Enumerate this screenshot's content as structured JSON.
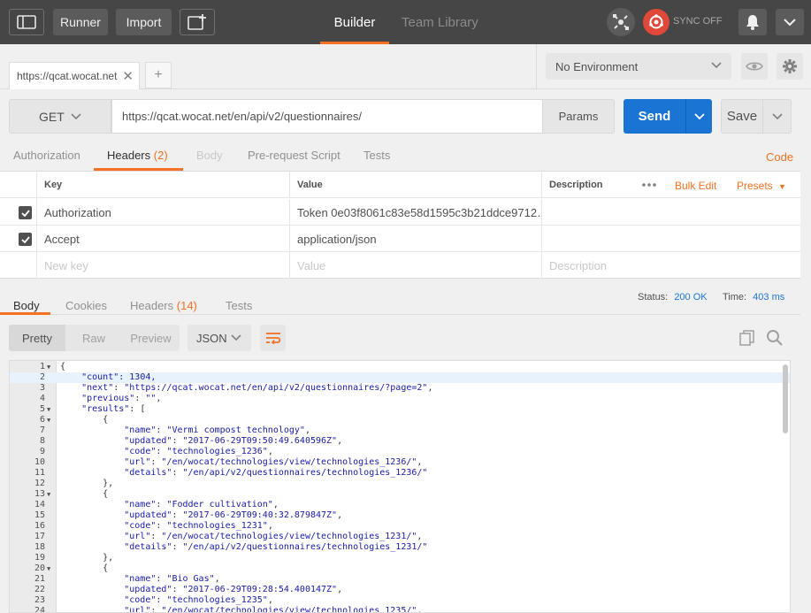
{
  "topbar": {
    "runner_label": "Runner",
    "import_label": "Import",
    "tabs": [
      {
        "label": "Builder",
        "active": true
      },
      {
        "label": "Team Library",
        "active": false
      }
    ],
    "sync_label": "SYNC OFF",
    "accent_color": "#f47023"
  },
  "request_tabs": {
    "active_tab_label": "https://qcat.wocat.net"
  },
  "environment": {
    "selected": "No Environment"
  },
  "request": {
    "method": "GET",
    "url": "https://qcat.wocat.net/en/api/v2/questionnaires/",
    "params_label": "Params",
    "send_label": "Send",
    "save_label": "Save",
    "send_color": "#1a74d4"
  },
  "request_subtabs": {
    "authorization": "Authorization",
    "headers": "Headers",
    "headers_count": "(2)",
    "body": "Body",
    "pre_request": "Pre-request Script",
    "tests": "Tests",
    "code_link": "Code"
  },
  "headers_table": {
    "columns": {
      "key": "Key",
      "value": "Value",
      "description": "Description"
    },
    "bulk_edit": "Bulk Edit",
    "presets": "Presets",
    "rows": [
      {
        "key": "Authorization",
        "value": "Token 0e03f8061c83e58d1595c3b21ddce9712…",
        "checked": true
      },
      {
        "key": "Accept",
        "value": "application/json",
        "checked": true
      }
    ],
    "placeholders": {
      "key": "New key",
      "value": "Value",
      "description": "Description"
    }
  },
  "response": {
    "tabs": {
      "body": "Body",
      "cookies": "Cookies",
      "headers": "Headers",
      "headers_count": "(14)",
      "tests": "Tests"
    },
    "status_label": "Status:",
    "status_value": "200 OK",
    "time_label": "Time:",
    "time_value": "403 ms",
    "views": [
      "Pretty",
      "Raw",
      "Preview"
    ],
    "format": "JSON"
  },
  "code_lines": [
    {
      "n": "1",
      "fold": true,
      "text": "{"
    },
    {
      "n": "2",
      "fold": false,
      "text": "    \"count\": 1304,"
    },
    {
      "n": "3",
      "fold": false,
      "text": "    \"next\": \"https://qcat.wocat.net/en/api/v2/questionnaires/?page=2\","
    },
    {
      "n": "4",
      "fold": false,
      "text": "    \"previous\": \"\","
    },
    {
      "n": "5",
      "fold": true,
      "text": "    \"results\": ["
    },
    {
      "n": "6",
      "fold": true,
      "text": "        {"
    },
    {
      "n": "7",
      "fold": false,
      "text": "            \"name\": \"Vermi compost technology\","
    },
    {
      "n": "8",
      "fold": false,
      "text": "            \"updated\": \"2017-06-29T09:50:49.640596Z\","
    },
    {
      "n": "9",
      "fold": false,
      "text": "            \"code\": \"technologies_1236\","
    },
    {
      "n": "10",
      "fold": false,
      "text": "            \"url\": \"/en/wocat/technologies/view/technologies_1236/\","
    },
    {
      "n": "11",
      "fold": false,
      "text": "            \"details\": \"/en/api/v2/questionnaires/technologies_1236/\""
    },
    {
      "n": "12",
      "fold": false,
      "text": "        },"
    },
    {
      "n": "13",
      "fold": true,
      "text": "        {"
    },
    {
      "n": "14",
      "fold": false,
      "text": "            \"name\": \"Fodder cultivation\","
    },
    {
      "n": "15",
      "fold": false,
      "text": "            \"updated\": \"2017-06-29T09:40:32.879847Z\","
    },
    {
      "n": "16",
      "fold": false,
      "text": "            \"code\": \"technologies_1231\","
    },
    {
      "n": "17",
      "fold": false,
      "text": "            \"url\": \"/en/wocat/technologies/view/technologies_1231/\","
    },
    {
      "n": "18",
      "fold": false,
      "text": "            \"details\": \"/en/api/v2/questionnaires/technologies_1231/\""
    },
    {
      "n": "19",
      "fold": false,
      "text": "        },"
    },
    {
      "n": "20",
      "fold": true,
      "text": "        {"
    },
    {
      "n": "21",
      "fold": false,
      "text": "            \"name\": \"Bio Gas\","
    },
    {
      "n": "22",
      "fold": false,
      "text": "            \"updated\": \"2017-06-29T09:28:54.400147Z\","
    },
    {
      "n": "23",
      "fold": false,
      "text": "            \"code\": \"technologies_1235\","
    },
    {
      "n": "24",
      "fold": false,
      "text": "            \"url\": \"/en/wocat/technologies/view/technologies_1235/\","
    }
  ]
}
